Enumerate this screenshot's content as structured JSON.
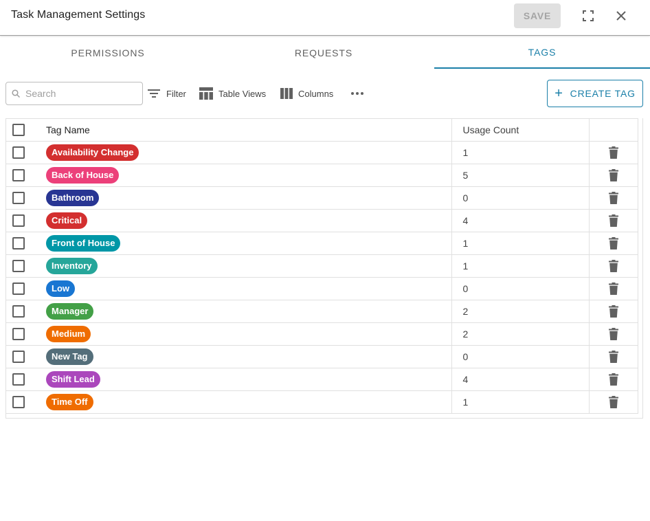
{
  "dialog": {
    "title": "Task Management Settings",
    "save_label": "SAVE",
    "expand_icon": "fullscreen-icon",
    "close_icon": "close-icon"
  },
  "tabs": [
    {
      "label": "PERMISSIONS",
      "active": false
    },
    {
      "label": "REQUESTS",
      "active": false
    },
    {
      "label": "TAGS",
      "active": true
    }
  ],
  "toolbar": {
    "search_placeholder": "Search",
    "filter_label": "Filter",
    "table_views_label": "Table Views",
    "columns_label": "Columns",
    "create_label": "CREATE TAG"
  },
  "table": {
    "headers": {
      "name": "Tag Name",
      "count": "Usage Count"
    },
    "rows": [
      {
        "name": "Availability Change",
        "color": "#d32f2f",
        "count": "1"
      },
      {
        "name": "Back of House",
        "color": "#ec407a",
        "count": "5"
      },
      {
        "name": "Bathroom",
        "color": "#283593",
        "count": "0"
      },
      {
        "name": "Critical",
        "color": "#d32f2f",
        "count": "4"
      },
      {
        "name": "Front of House",
        "color": "#0097a7",
        "count": "1"
      },
      {
        "name": "Inventory",
        "color": "#26a69a",
        "count": "1"
      },
      {
        "name": "Low",
        "color": "#1976d2",
        "count": "0"
      },
      {
        "name": "Manager",
        "color": "#43a047",
        "count": "2"
      },
      {
        "name": "Medium",
        "color": "#ef6c00",
        "count": "2"
      },
      {
        "name": "New Tag",
        "color": "#546e7a",
        "count": "0"
      },
      {
        "name": "Shift Lead",
        "color": "#ab47bc",
        "count": "4"
      },
      {
        "name": "Time Off",
        "color": "#ef6c00",
        "count": "1"
      }
    ]
  },
  "colors": {
    "accent": "#1a7fa8",
    "save_disabled_bg": "#e0e0e0",
    "icon_gray": "#616161"
  }
}
